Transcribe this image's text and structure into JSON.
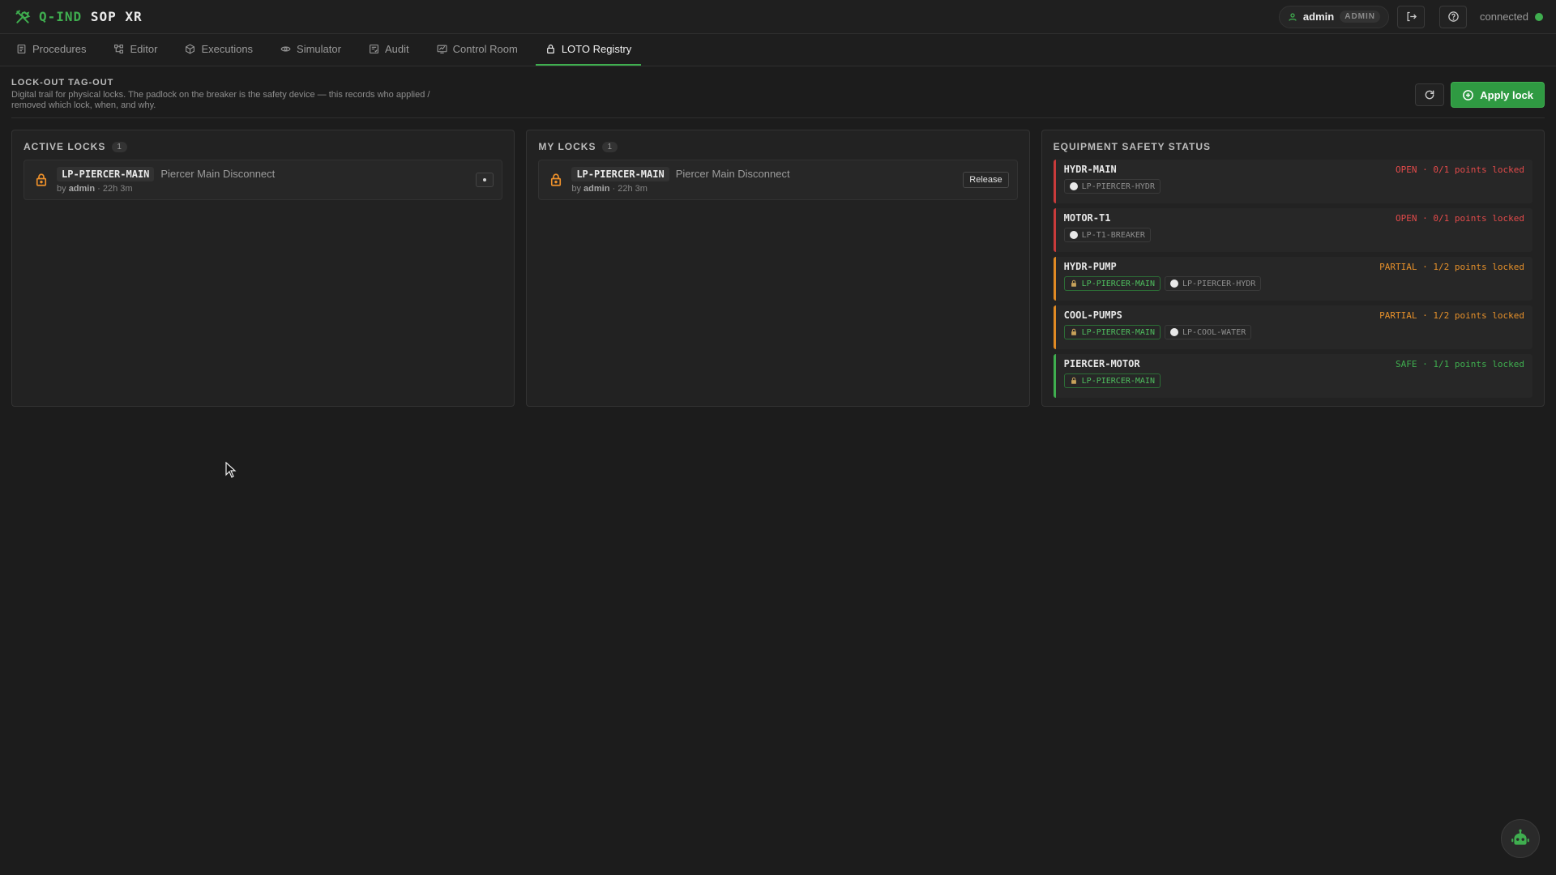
{
  "app": {
    "brand_accent": "Q-IND",
    "brand_main": "SOP XR",
    "user": "admin",
    "role": "ADMIN",
    "connection": "connected"
  },
  "tabs": [
    {
      "label": "Procedures",
      "icon": "document-icon"
    },
    {
      "label": "Editor",
      "icon": "flow-icon"
    },
    {
      "label": "Executions",
      "icon": "cube-icon"
    },
    {
      "label": "Simulator",
      "icon": "eye-icon"
    },
    {
      "label": "Audit",
      "icon": "audit-icon"
    },
    {
      "label": "Control Room",
      "icon": "monitor-icon"
    },
    {
      "label": "LOTO Registry",
      "icon": "lock-icon",
      "active": true
    }
  ],
  "header": {
    "title": "LOCK-OUT TAG-OUT",
    "description": "Digital trail for physical locks. The padlock on the breaker is the safety device — this records who applied / removed which lock, when, and why.",
    "apply_label": "Apply lock"
  },
  "active_locks": {
    "title": "ACTIVE LOCKS",
    "count": "1",
    "items": [
      {
        "code": "LP-PIERCER-MAIN",
        "name": "Piercer Main Disconnect",
        "by_prefix": "by",
        "user": "admin",
        "age": "· 22h 3m"
      }
    ]
  },
  "my_locks": {
    "title": "MY LOCKS",
    "count": "1",
    "items": [
      {
        "code": "LP-PIERCER-MAIN",
        "name": "Piercer Main Disconnect",
        "by_prefix": "by",
        "user": "admin",
        "age": "· 22h 3m",
        "action": "Release"
      }
    ]
  },
  "equipment": {
    "title": "EQUIPMENT SAFETY STATUS",
    "items": [
      {
        "name": "HYDR-MAIN",
        "status": "OPEN · 0/1 points locked",
        "state": "open",
        "points": [
          {
            "label": "LP-PIERCER-HYDR",
            "locked": false
          }
        ]
      },
      {
        "name": "MOTOR-T1",
        "status": "OPEN · 0/1 points locked",
        "state": "open",
        "points": [
          {
            "label": "LP-T1-BREAKER",
            "locked": false
          }
        ]
      },
      {
        "name": "HYDR-PUMP",
        "status": "PARTIAL · 1/2 points locked",
        "state": "partial",
        "points": [
          {
            "label": "LP-PIERCER-MAIN",
            "locked": true
          },
          {
            "label": "LP-PIERCER-HYDR",
            "locked": false
          }
        ]
      },
      {
        "name": "COOL-PUMPS",
        "status": "PARTIAL · 1/2 points locked",
        "state": "partial",
        "points": [
          {
            "label": "LP-PIERCER-MAIN",
            "locked": true
          },
          {
            "label": "LP-COOL-WATER",
            "locked": false
          }
        ]
      },
      {
        "name": "PIERCER-MOTOR",
        "status": "SAFE · 1/1 points locked",
        "state": "safe",
        "points": [
          {
            "label": "LP-PIERCER-MAIN",
            "locked": true
          }
        ]
      }
    ]
  },
  "colors": {
    "accent": "#3fae4f",
    "open": "#e24a4a",
    "partial": "#e6902a",
    "safe": "#3fae4f",
    "lock": "#f0922b"
  }
}
